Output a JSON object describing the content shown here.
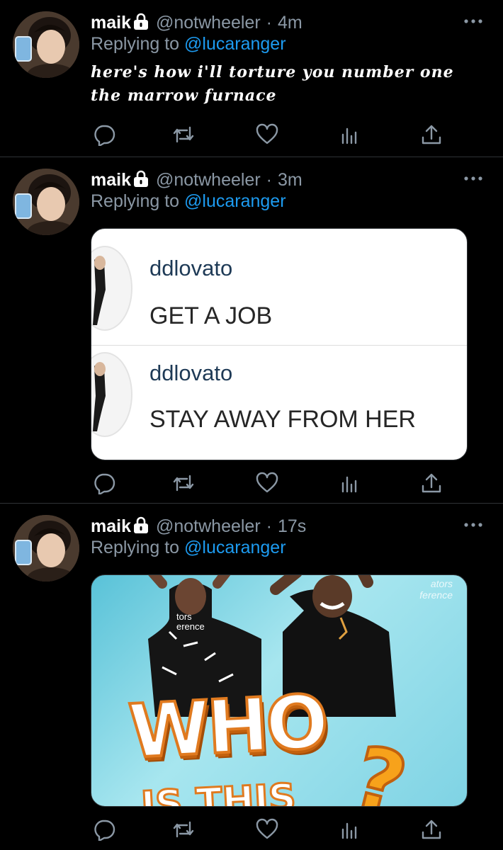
{
  "tweets": [
    {
      "name": "maik",
      "handle": "@notwheeler",
      "separator": "·",
      "time": "4m",
      "reply_prefix": "Replying to ",
      "reply_to": "@lucaranger",
      "text": "here's how i'll torture you number one\nthe marrow furnace"
    },
    {
      "name": "maik",
      "handle": "@notwheeler",
      "separator": "·",
      "time": "3m",
      "reply_prefix": "Replying to ",
      "reply_to": "@lucaranger",
      "media": {
        "comments": [
          {
            "user": "ddlovato",
            "text": "GET A JOB"
          },
          {
            "user": "ddlovato",
            "text": "STAY AWAY FROM HER"
          }
        ]
      }
    },
    {
      "name": "maik",
      "handle": "@notwheeler",
      "separator": "·",
      "time": "17s",
      "reply_prefix": "Replying to ",
      "reply_to": "@lucaranger",
      "media": {
        "title": "WHO",
        "subtitle": "IS THIS",
        "mark": "?",
        "sign_right": "ators\nference",
        "sign_left": "tors\nerence"
      }
    }
  ],
  "icons": {
    "lock": "lock-icon",
    "more": "more-icon",
    "reply": "reply-icon",
    "retweet": "retweet-icon",
    "like": "heart-icon",
    "stats": "stats-icon",
    "share": "share-icon"
  },
  "colors": {
    "background": "#000000",
    "text": "#ffffff",
    "muted": "#8b98a5",
    "link": "#1d9bf0",
    "divider": "#2f3336"
  }
}
